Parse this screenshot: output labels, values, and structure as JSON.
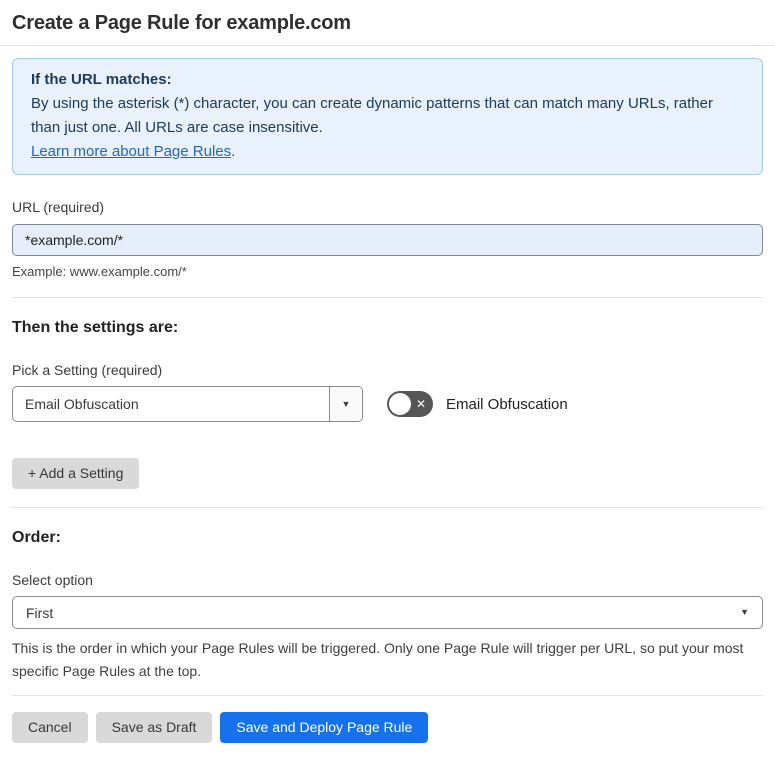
{
  "page": {
    "title": "Create a Page Rule for example.com"
  },
  "info_box": {
    "heading": "If the URL matches:",
    "body": "By using the asterisk (*) character, you can create dynamic patterns that can match many URLs, rather than just one. All URLs are case insensitive.",
    "link_label": "Learn more about Page Rules",
    "link_suffix": "."
  },
  "url_field": {
    "label": "URL (required)",
    "value": "*example.com/*",
    "example": "Example: www.example.com/*"
  },
  "settings_section": {
    "heading": "Then the settings are:",
    "picker_label": "Pick a Setting (required)",
    "picker_value": "Email Obfuscation",
    "toggle_label": "Email Obfuscation",
    "toggle_state": "off",
    "add_button_label": "+ Add a Setting"
  },
  "order_section": {
    "heading": "Order:",
    "select_label": "Select option",
    "select_value": "First",
    "help_text": "This is the order in which your Page Rules will be triggered. Only one Page Rule will trigger per URL, so put your most specific Page Rules at the top."
  },
  "footer": {
    "cancel_label": "Cancel",
    "save_draft_label": "Save as Draft",
    "save_deploy_label": "Save and Deploy Page Rule"
  },
  "icons": {
    "dropdown_arrow": "▼",
    "toggle_off_x": "✕"
  },
  "colors": {
    "accent_blue": "#1672ec",
    "info_bg": "#e9f2fc",
    "info_border": "#a5c9ec",
    "info_text": "#1d3a60",
    "link_blue": "#2466c2",
    "input_bg": "#e7eefb",
    "toggle_bg": "#565656",
    "button_gray": "#d9d9d9"
  }
}
